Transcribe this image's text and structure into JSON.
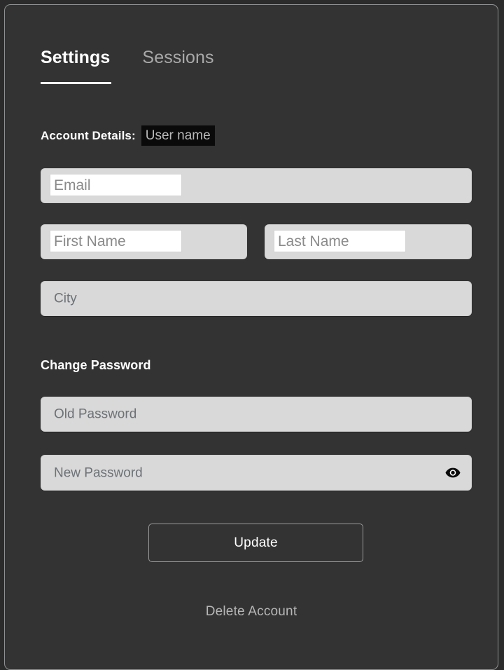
{
  "window": {
    "background_color": "#333333",
    "border_color": "#8e9091"
  },
  "tabs": [
    {
      "label": "Settings",
      "active": true
    },
    {
      "label": "Sessions",
      "active": false
    }
  ],
  "account_details": {
    "label": "Account Details:",
    "username_value": "User name",
    "username_highlight_color": "#0a0a0a"
  },
  "fields": {
    "email": {
      "placeholder": "Email"
    },
    "first_name": {
      "placeholder": "First Name"
    },
    "last_name": {
      "placeholder": "Last Name"
    },
    "city": {
      "placeholder": "City"
    },
    "old_password": {
      "placeholder": "Old Password"
    },
    "new_password": {
      "placeholder": "New Password",
      "toggle_icon": "eye-icon"
    }
  },
  "change_password": {
    "heading": "Change Password"
  },
  "actions": {
    "update_label": "Update",
    "delete_label": "Delete Account"
  },
  "colors": {
    "field_background": "#d9d9d9",
    "field_inner": "#ffffff",
    "placeholder_text": "#6d7277",
    "accent_text": "#ffffff",
    "muted_text": "#a9a9a9"
  }
}
